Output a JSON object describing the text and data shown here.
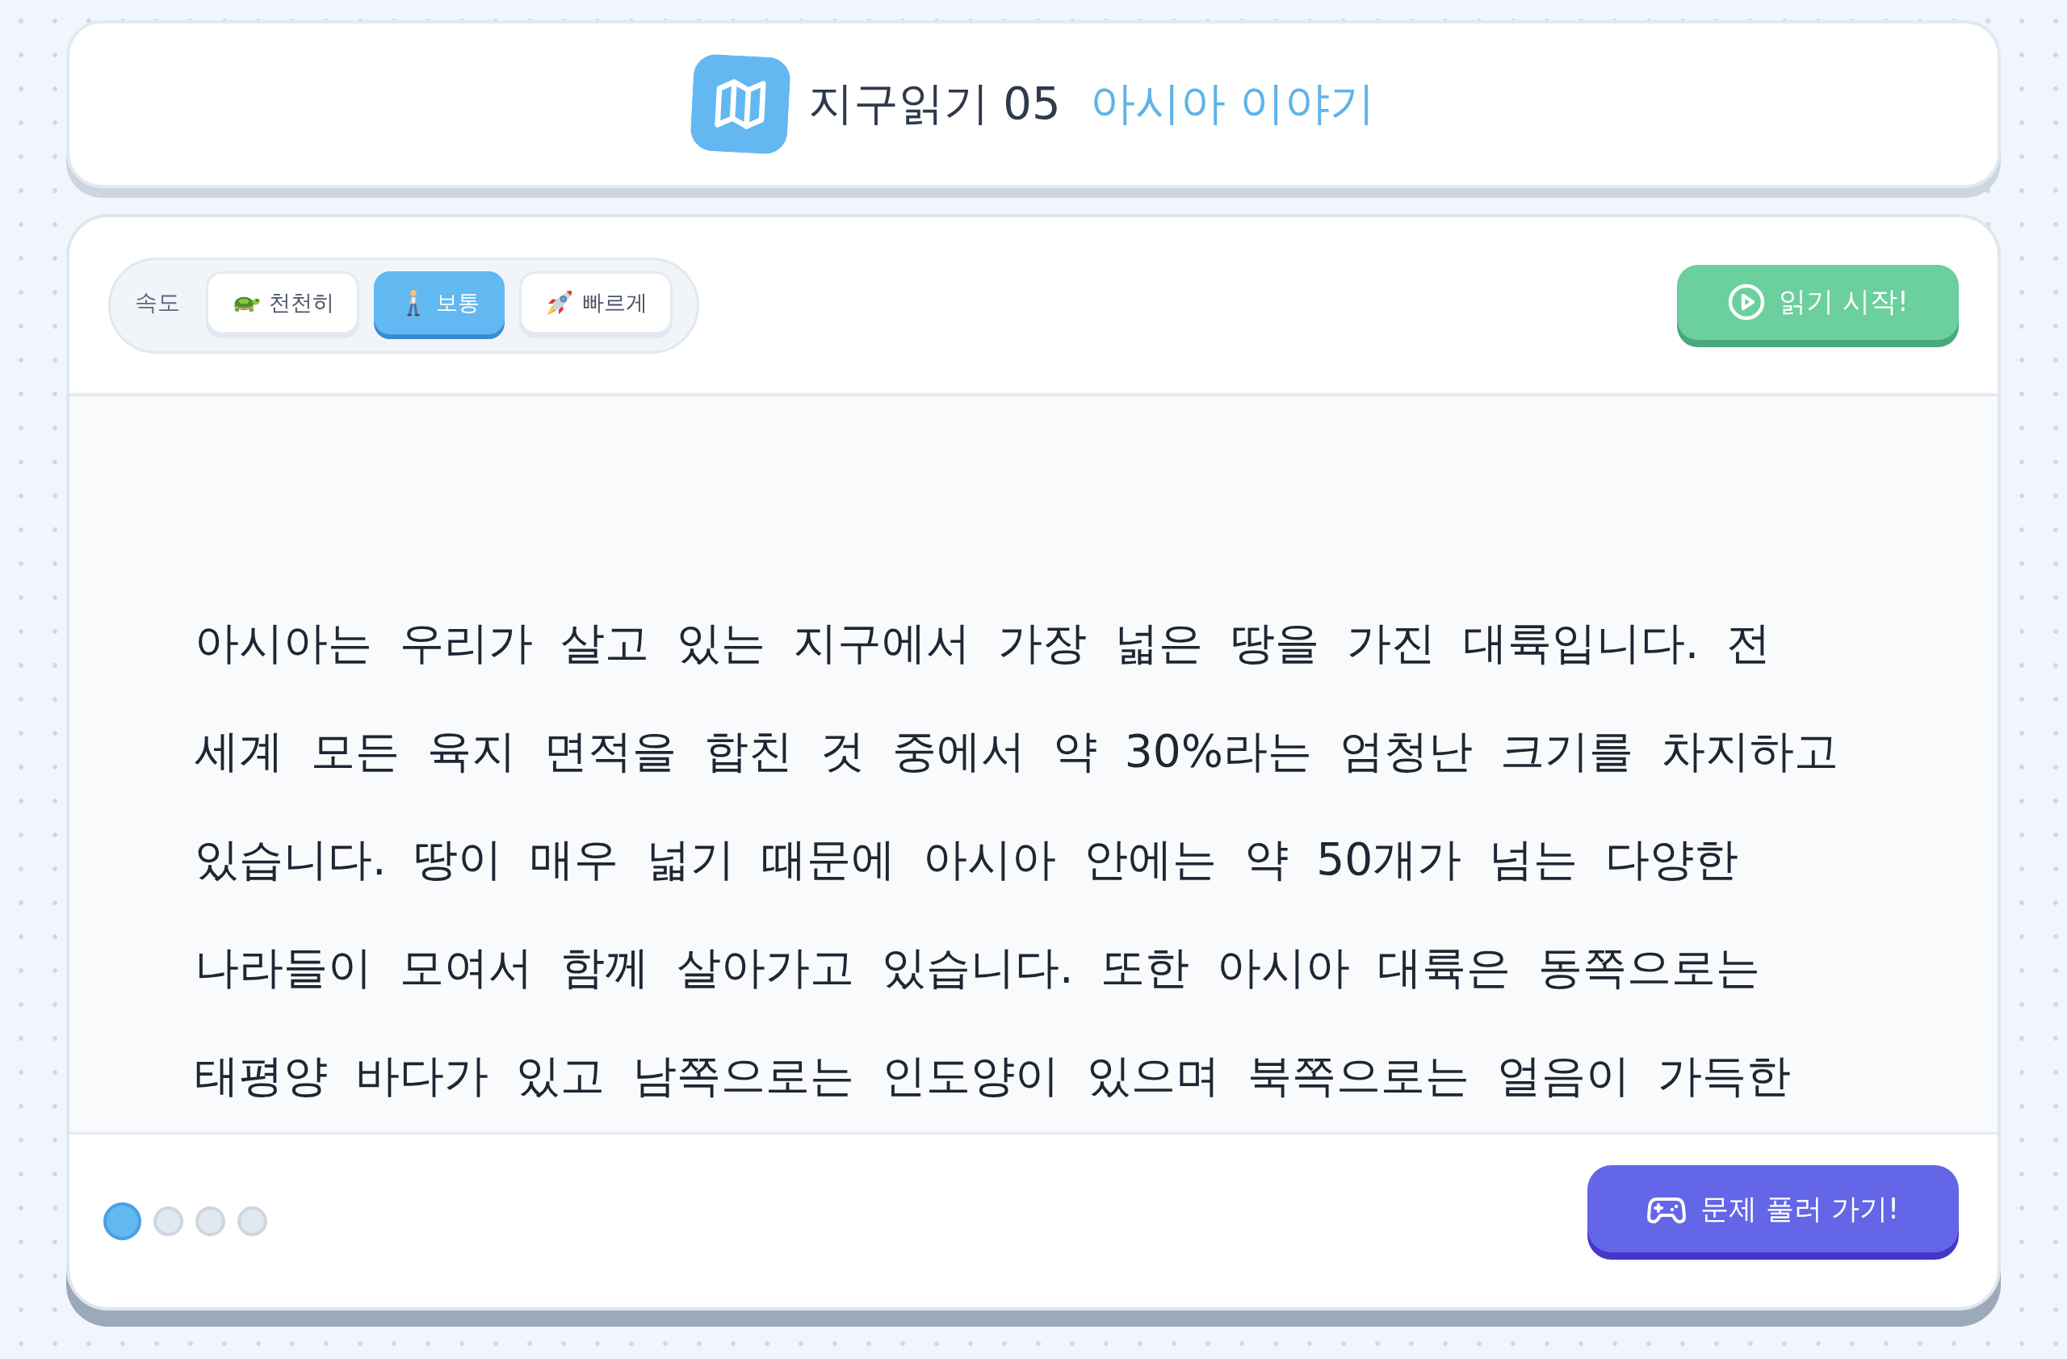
{
  "header": {
    "title": "지구읽기 05",
    "subtitle": "아시아 이야기"
  },
  "speed": {
    "label": "속도",
    "options": [
      {
        "label": "천천히",
        "kind": "turtle",
        "selected": false
      },
      {
        "label": "보통",
        "kind": "walker",
        "selected": true
      },
      {
        "label": "빠르게",
        "kind": "rocket",
        "selected": false
      }
    ]
  },
  "start_button": {
    "label": "읽기 시작!"
  },
  "passage": {
    "text": "아시아는 우리가 살고 있는 지구에서 가장 넓은 땅을 가진 대륙입니다. 전 세계 모든 육지 면적을 합친 것 중에서 약 30%라는 엄청난 크기를 차지하고 있습니다. 땅이 매우 넓기 때문에 아시아 안에는 약 50개가 넘는 다양한 나라들이 모여서 함께 살아가고 있습니다. 또한 아시아 대륙은 동쪽으로는 태평양 바다가 있고 남쪽으로는 인도양이 있으며 북쪽으로는 얼음이 가득한"
  },
  "pages": [
    {
      "selected": true
    },
    {
      "selected": false
    },
    {
      "selected": false
    },
    {
      "selected": false
    }
  ],
  "quiz_button": {
    "label": "문제 풀러 가기!"
  }
}
